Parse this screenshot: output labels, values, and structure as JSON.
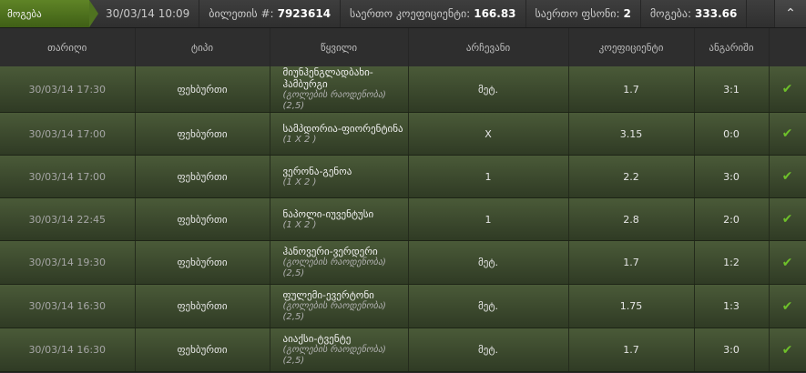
{
  "header": {
    "status": "მოგება",
    "date": "30/03/14 10:09",
    "ticket_label": "ბილეთის #:",
    "ticket_number": "7923614",
    "total_odds_label": "საერთო კოეფიციენტი:",
    "total_odds": "166.83",
    "total_stake_label": "საერთო ფსონი:",
    "total_stake": "2",
    "winnings_label": "მოგება:",
    "winnings": "333.66",
    "collapse_icon": "double-chevron-up-icon"
  },
  "columns": [
    "თარიღი",
    "ტიპი",
    "წყვილი",
    "არჩევანი",
    "კოეფიციენტი",
    "ანგარიში"
  ],
  "rows": [
    {
      "date": "30/03/14 17:30",
      "type": "ფეხბურთი",
      "event": "მიუნჰენგლადბახი-ჰამბურგი",
      "market": "(გოლების რაოდენობა) (2,5)",
      "pick": "მეტ.",
      "odds": "1.7",
      "score": "3:1"
    },
    {
      "date": "30/03/14 17:00",
      "type": "ფეხბურთი",
      "event": "სამპდორია-ფიორენტინა",
      "market": "(1 X 2 )",
      "pick": "X",
      "odds": "3.15",
      "score": "0:0"
    },
    {
      "date": "30/03/14 17:00",
      "type": "ფეხბურთი",
      "event": "ვერონა-გენოა",
      "market": "(1 X 2 )",
      "pick": "1",
      "odds": "2.2",
      "score": "3:0"
    },
    {
      "date": "30/03/14 22:45",
      "type": "ფეხბურთი",
      "event": "ნაპოლი-იუვენტუსი",
      "market": "(1 X 2 )",
      "pick": "1",
      "odds": "2.8",
      "score": "2:0"
    },
    {
      "date": "30/03/14 19:30",
      "type": "ფეხბურთი",
      "event": "ჰანოვერი-ვერდერი",
      "market": "(გოლების რაოდენობა) (2,5)",
      "pick": "მეტ.",
      "odds": "1.7",
      "score": "1:2"
    },
    {
      "date": "30/03/14 16:30",
      "type": "ფეხბურთი",
      "event": "ფულემი-ევერტონი",
      "market": "(გოლების რაოდენობა) (2,5)",
      "pick": "მეტ.",
      "odds": "1.75",
      "score": "1:3"
    },
    {
      "date": "30/03/14 16:30",
      "type": "ფეხბურთი",
      "event": "აიაქსი-ტვენტე",
      "market": "(გოლების რაოდენობა) (2,5)",
      "pick": "მეტ.",
      "odds": "1.7",
      "score": "3:0"
    }
  ],
  "row_status_icon": "check-icon",
  "colors": {
    "win_tab": "#4f7220",
    "check": "#6ec02a"
  }
}
